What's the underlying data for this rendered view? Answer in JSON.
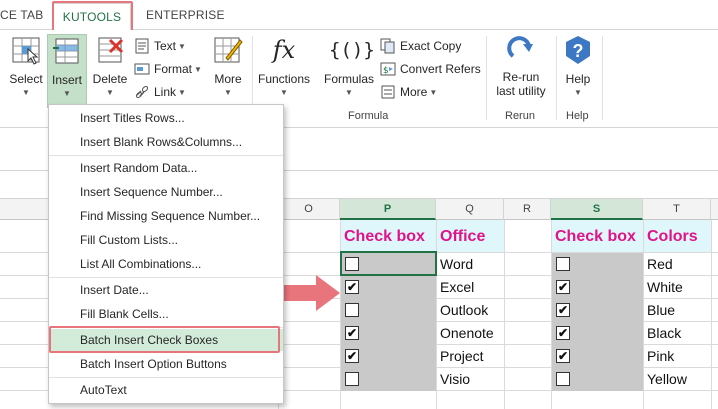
{
  "ribbon_tabs": [
    {
      "label": "CE TAB"
    },
    {
      "label": "KUTOOLS"
    },
    {
      "label": "ENTERPRISE"
    }
  ],
  "ribbon": {
    "select": "Select",
    "insert": "Insert",
    "delete": "Delete",
    "text": "Text",
    "format": "Format",
    "link": "Link",
    "more": "More",
    "functions": "Functions",
    "formulas": "Formulas",
    "exact_copy": "Exact Copy",
    "convert_refers": "Convert Refers",
    "more2": "More",
    "formula_group": "Formula",
    "rerun_line1": "Re-run",
    "rerun_line2": "last utility",
    "rerun_group": "Rerun",
    "help": "Help",
    "help_group": "Help"
  },
  "menu_items": [
    "Insert Titles Rows...",
    "Insert Blank Rows&Columns...",
    "Insert Random Data...",
    "Insert Sequence Number...",
    "Find Missing Sequence Number...",
    "Fill Custom Lists...",
    "List All Combinations...",
    "Insert Date...",
    "Fill Blank Cells...",
    "Batch Insert Check Boxes",
    "Batch Insert Option Buttons",
    "AutoText"
  ],
  "columns": [
    "O",
    "P",
    "Q",
    "R",
    "S",
    "T"
  ],
  "table1": {
    "header_cb": "Check box",
    "header_val": "Office",
    "rows": [
      {
        "checked": "",
        "value": "Word"
      },
      {
        "checked": "✔",
        "value": "Excel"
      },
      {
        "checked": "",
        "value": "Outlook"
      },
      {
        "checked": "✔",
        "value": "Onenote"
      },
      {
        "checked": "✔",
        "value": "Project"
      },
      {
        "checked": "",
        "value": "Visio"
      }
    ]
  },
  "table2": {
    "header_cb": "Check box",
    "header_val": "Colors",
    "rows": [
      {
        "checked": "",
        "value": "Red"
      },
      {
        "checked": "✔",
        "value": "White"
      },
      {
        "checked": "✔",
        "value": "Blue"
      },
      {
        "checked": "✔",
        "value": "Black"
      },
      {
        "checked": "✔",
        "value": "Pink"
      },
      {
        "checked": "",
        "value": "Yellow"
      }
    ]
  },
  "colors": {
    "accent_green": "#217346",
    "highlight_red": "#e8757c",
    "header_pink": "#e0148a",
    "header_bg": "#dff6fb",
    "arrow": "#e8757c"
  }
}
